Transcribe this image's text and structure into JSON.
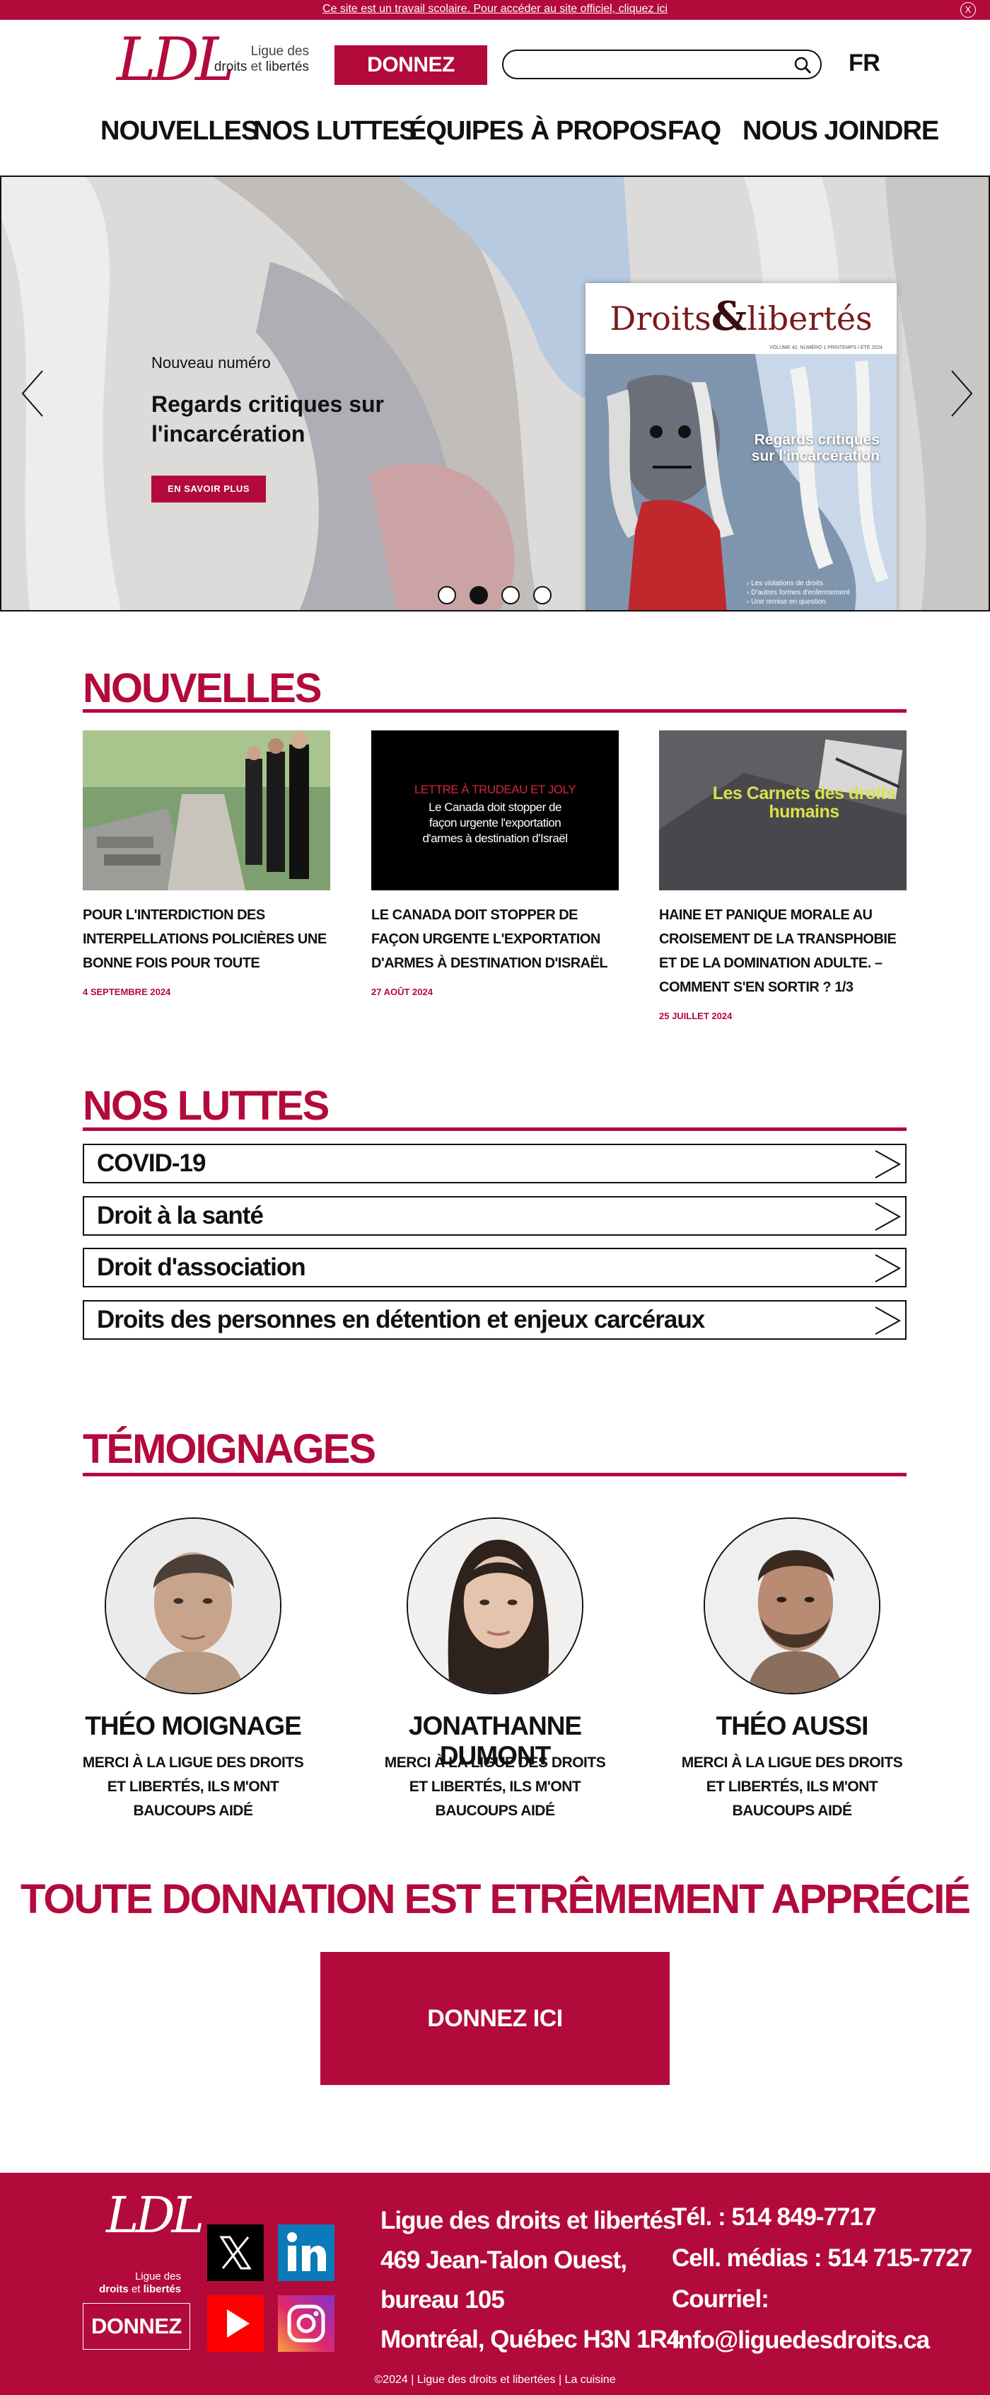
{
  "notice": {
    "text": "Ce site est un travail scolaire. Pour accéder au site officiel, cliquez ici",
    "close": "X"
  },
  "header": {
    "logo_mark": "LDL",
    "logo_line1": "Ligue des",
    "logo_line2a": "droits",
    "logo_line2b": "et",
    "logo_line2c": "libertés",
    "donate_label": "DONNEZ",
    "search_value": "",
    "lang_label": "FR"
  },
  "nav": {
    "items": [
      {
        "label": "NOUVELLES"
      },
      {
        "label": "NOS LUTTES"
      },
      {
        "label": "ÉQUIPES"
      },
      {
        "label": "À PROPOS"
      },
      {
        "label": "FAQ"
      },
      {
        "label": "NOUS JOINDRE"
      }
    ]
  },
  "hero": {
    "kicker": "Nouveau numéro",
    "headline": "Regards critiques sur l'incarcération",
    "cta_label": "EN SAVOIR PLUS",
    "cover": {
      "title_a": "Droits",
      "title_amp": "&",
      "title_b": "libertés",
      "small_line": "VOLUME 42, NUMÉRO 1 PRINTEMPS / ÉTÉ 2024",
      "headline": "Regards critiques sur l'incarcération",
      "list": [
        "› Les violations de droits",
        "› D'autres formes d'enfermement",
        "› Une remise en question"
      ]
    },
    "active_slide": 2,
    "slide_count": 4
  },
  "news": {
    "title": "NOUVELLES",
    "items": [
      {
        "title": "POUR L'INTERDICTION DES INTERPELLATIONS POLICIÈRES UNE BONNE FOIS POUR TOUTE",
        "date": "4 SEPTEMBRE 2024"
      },
      {
        "title": "LE CANADA DOIT STOPPER DE FAÇON URGENTE L'EXPORTATION D'ARMES À DESTINATION D'ISRAËL",
        "date": "27 AOÛT 2024",
        "thumb_kicker": "LETTRE À TRUDEAU ET JOLY",
        "thumb_text": "Le Canada doit stopper de façon urgente l'exportation d'armes à destination d'Israël"
      },
      {
        "title": "HAINE ET PANIQUE MORALE AU CROISEMENT DE LA TRANSPHOBIE ET DE LA DOMINATION ADULTE. – COMMENT S'EN SORTIR ? 1/3",
        "date": "25 JUILLET 2024",
        "thumb_text": "Les Carnets des droits humains"
      }
    ]
  },
  "luttes": {
    "title": "NOS LUTTES",
    "items": [
      {
        "label": "COVID-19"
      },
      {
        "label": "Droit à la santé"
      },
      {
        "label": "Droit d'association"
      },
      {
        "label": "Droits des personnes en détention et enjeux carcéraux"
      }
    ]
  },
  "temoignages": {
    "title": "TÉMOIGNAGES",
    "items": [
      {
        "name": "THÉO MOIGNAGE",
        "quote": "MERCI À LA LIGUE DES DROITS ET LIBERTÉS, ILS M'ONT BAUCOUPS AIDÉ"
      },
      {
        "name": "JONATHANNE DUMONT",
        "quote": "MERCI À LA LIGUE DES DROITS ET LIBERTÉS, ILS M'ONT BAUCOUPS AIDÉ"
      },
      {
        "name": "THÉO AUSSI",
        "quote": "MERCI À LA LIGUE DES DROITS ET LIBERTÉS, ILS M'ONT BAUCOUPS AIDÉ"
      }
    ]
  },
  "donation": {
    "title": "TOUTE DONNATION EST ETRÊMEMENT APPRÉCIÉ",
    "button": "DONNEZ ICI"
  },
  "footer": {
    "logo_mark": "LDL",
    "logo_line1": "Ligue des",
    "logo_line2a": "droits",
    "logo_line2b": "et",
    "logo_line2c": "libertés",
    "donate_label": "DONNEZ",
    "address": [
      "Ligue des droits et libertés",
      "469 Jean-Talon Ouest,",
      "bureau 105",
      "Montréal, Québec H3N 1R4"
    ],
    "contact": [
      "Tél. : 514 849-7717",
      "Cell. médias : 514 715-7727",
      "Courriel:",
      "info@liguedesdroits.ca"
    ],
    "copyright": "©2024 | Ligue des droits et libertées | La cuisine",
    "social": [
      "x-icon",
      "linkedin-icon",
      "youtube-icon",
      "instagram-icon"
    ]
  },
  "colors": {
    "brand": "#b30a3c",
    "text": "#111111"
  }
}
